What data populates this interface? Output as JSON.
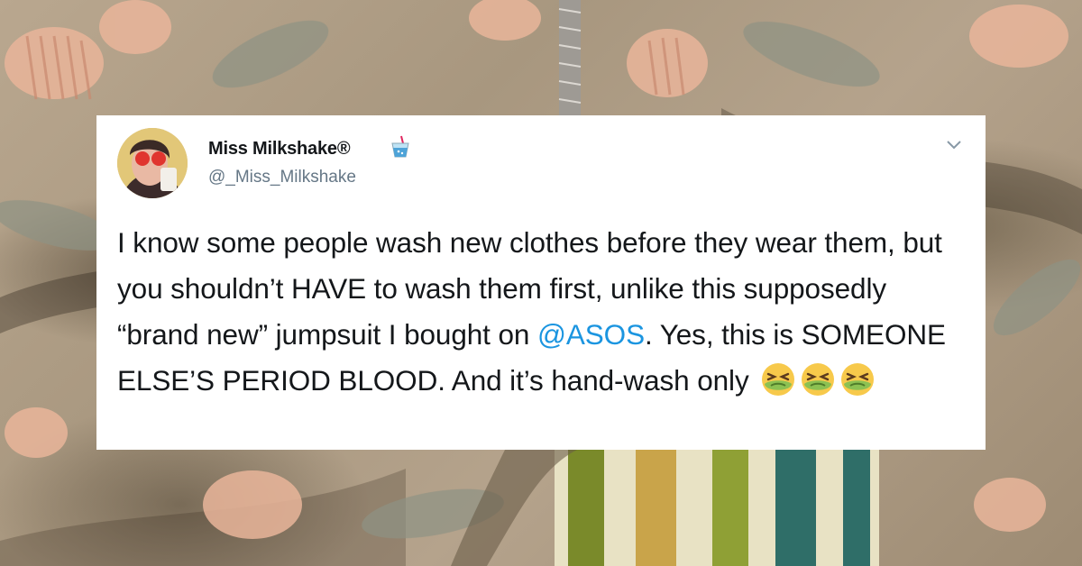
{
  "tweet": {
    "display_name": "Miss Milkshake®",
    "name_badge_icon": "milkshake-cup-icon",
    "handle": "@_Miss_Milkshake",
    "menu_icon": "chevron-down-icon",
    "text_part_1": "I know some people wash new clothes before they wear them, but you shouldn’t HAVE to wash them first, unlike this supposedly “brand new” jumpsuit I bought on ",
    "mention": "@ASOS",
    "text_part_2": ". Yes, this is SOMEONE ELSE’S PERIOD BLOOD. And it’s hand-wash only",
    "emoji_icon": "nauseated-face-icon",
    "emoji_count": 3
  },
  "colors": {
    "card_bg": "#ffffff",
    "text": "#14171a",
    "secondary_text": "#657786",
    "link": "#1b95e0"
  }
}
